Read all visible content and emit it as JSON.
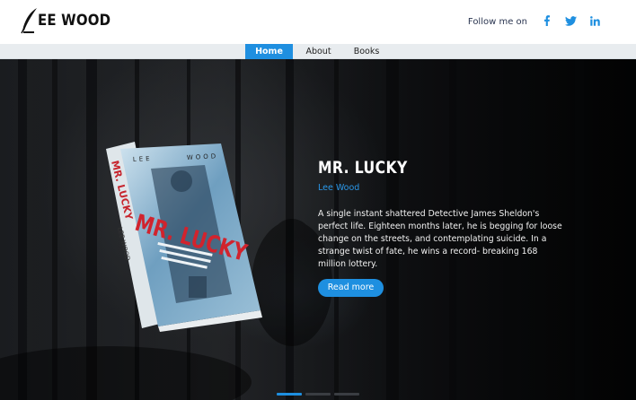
{
  "header": {
    "logo_text": "EE WOOD",
    "follow_label": "Follow me on",
    "social": [
      {
        "name": "facebook-icon",
        "color": "#1e8fe0"
      },
      {
        "name": "twitter-icon",
        "color": "#1e8fe0"
      },
      {
        "name": "linkedin-icon",
        "color": "#1e8fe0"
      }
    ]
  },
  "nav": {
    "items": [
      {
        "label": "Home",
        "active": true
      },
      {
        "label": "About",
        "active": false
      },
      {
        "label": "Books",
        "active": false
      }
    ]
  },
  "hero": {
    "title": "MR. LUCKY",
    "author": "Lee Wood",
    "description": "A single instant shattered Detective James Sheldon's perfect life. Eighteen months later, he is begging for loose change on the streets, and contemplating suicide. In a strange twist of fate, he wins a record- breaking 168 million lottery.",
    "button_label": "Read more",
    "book_cover": {
      "top_left": "LEE",
      "top_right": "WOOD",
      "spine_title": "MR. LUCKY",
      "spine_author": "LEE WOOD",
      "cover_title": "MR. LUCKY"
    },
    "slides": 3,
    "active_slide": 0
  },
  "colors": {
    "accent": "#1e8fe0",
    "nav_bg": "#e8ecef"
  }
}
